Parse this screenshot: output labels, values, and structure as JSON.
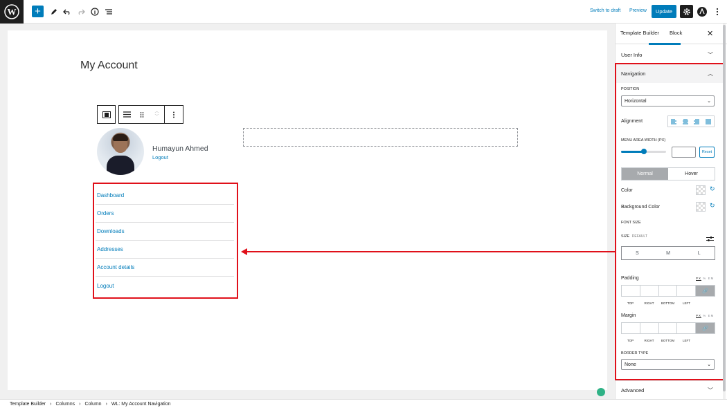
{
  "toolbar": {
    "add_icon": "plus-icon",
    "switch_to_draft": "Switch to draft",
    "preview": "Preview",
    "update": "Update"
  },
  "canvas": {
    "page_title": "My Account",
    "user_name": "Humayun Ahmed",
    "user_logout": "Logout",
    "nav_items": [
      "Dashboard",
      "Orders",
      "Downloads",
      "Addresses",
      "Account details",
      "Logout"
    ]
  },
  "sidebar": {
    "tabs": [
      "Template Builder",
      "Block"
    ],
    "active_tab": "Block",
    "panels": {
      "user_info": "User Info",
      "navigation": "Navigation",
      "advanced": "Advanced"
    },
    "position_label": "POSITION",
    "position_value": "Horizontal",
    "alignment_label": "Alignment",
    "menu_width_label": "MENU AREA WIDTH (PX)",
    "menu_width_value": 0.5,
    "reset_label": "Reset",
    "state_tabs": [
      "Normal",
      "Hover"
    ],
    "active_state": "Normal",
    "color_label": "Color",
    "bg_color_label": "Background Color",
    "font_size_label": "FONT SIZE",
    "size_label": "SIZE",
    "size_default": "DEFAULT",
    "size_options": [
      "S",
      "M",
      "L"
    ],
    "padding_label": "Padding",
    "margin_label": "Margin",
    "units": [
      "PX",
      "%",
      "EM"
    ],
    "box_sides": [
      "TOP",
      "RIGHT",
      "BOTTOM",
      "LEFT"
    ],
    "border_type_label": "BORDER TYPE",
    "border_type_value": "None"
  },
  "breadcrumb": [
    "Template Builder",
    "Columns",
    "Column",
    "WL: My Account Navigation"
  ],
  "colors": {
    "accent": "#007cba",
    "highlight": "#e0101a",
    "dark": "#1e1e1e"
  }
}
